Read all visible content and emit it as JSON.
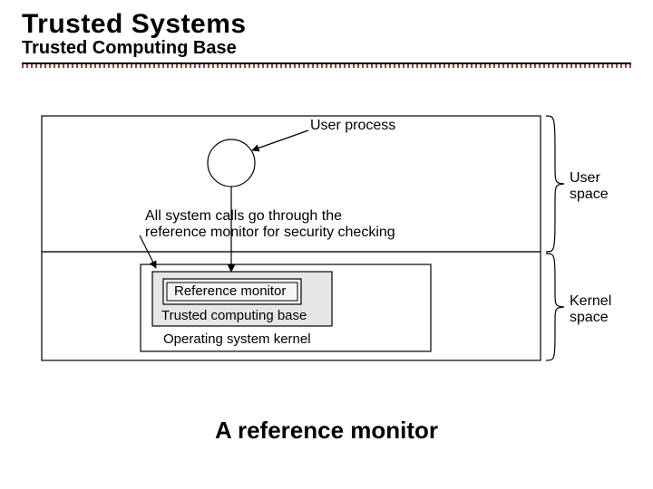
{
  "header": {
    "title": "Trusted Systems",
    "subtitle": "Trusted Computing Base"
  },
  "diagram": {
    "user_process": "User process",
    "syscall_note_line1": "All system calls go through the",
    "syscall_note_line2": "reference monitor for security checking",
    "ref_monitor": "Reference monitor",
    "tcb": "Trusted computing base",
    "os_kernel": "Operating system kernel",
    "user_space": "User\nspace",
    "kernel_space": "Kernel\nspace"
  },
  "caption": "A reference monitor"
}
